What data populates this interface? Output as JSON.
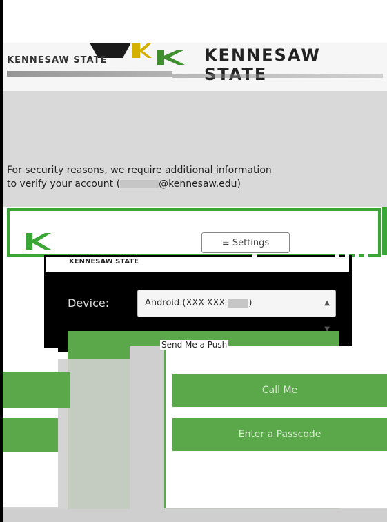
{
  "header": {
    "university_name": "KENNESAW STATE",
    "university_small": "KENNESAW STATE"
  },
  "message": {
    "line1": "For security reasons, we require additional information",
    "line2_prefix": "to verify your account (",
    "line2_suffix": "@kennesaw.edu)"
  },
  "panel": {
    "settings_label": "≡ Settings",
    "banner_text": "KENNESAW STATE"
  },
  "device": {
    "label": "Device:",
    "selected": "Android (XXX-XXX-",
    "selected_suffix": ")"
  },
  "actions": {
    "push_label": "Send Me a Push",
    "call_label": "Call Me",
    "passcode_label": "Enter a Passcode"
  },
  "colors": {
    "accent_green": "#5aa84a",
    "frame_green": "#3aa635",
    "gold": "#d4b000"
  },
  "icons": {
    "logo": "ksu-logo-icon",
    "select_arrows": "updown-arrows-icon",
    "settings": "menu-icon"
  }
}
